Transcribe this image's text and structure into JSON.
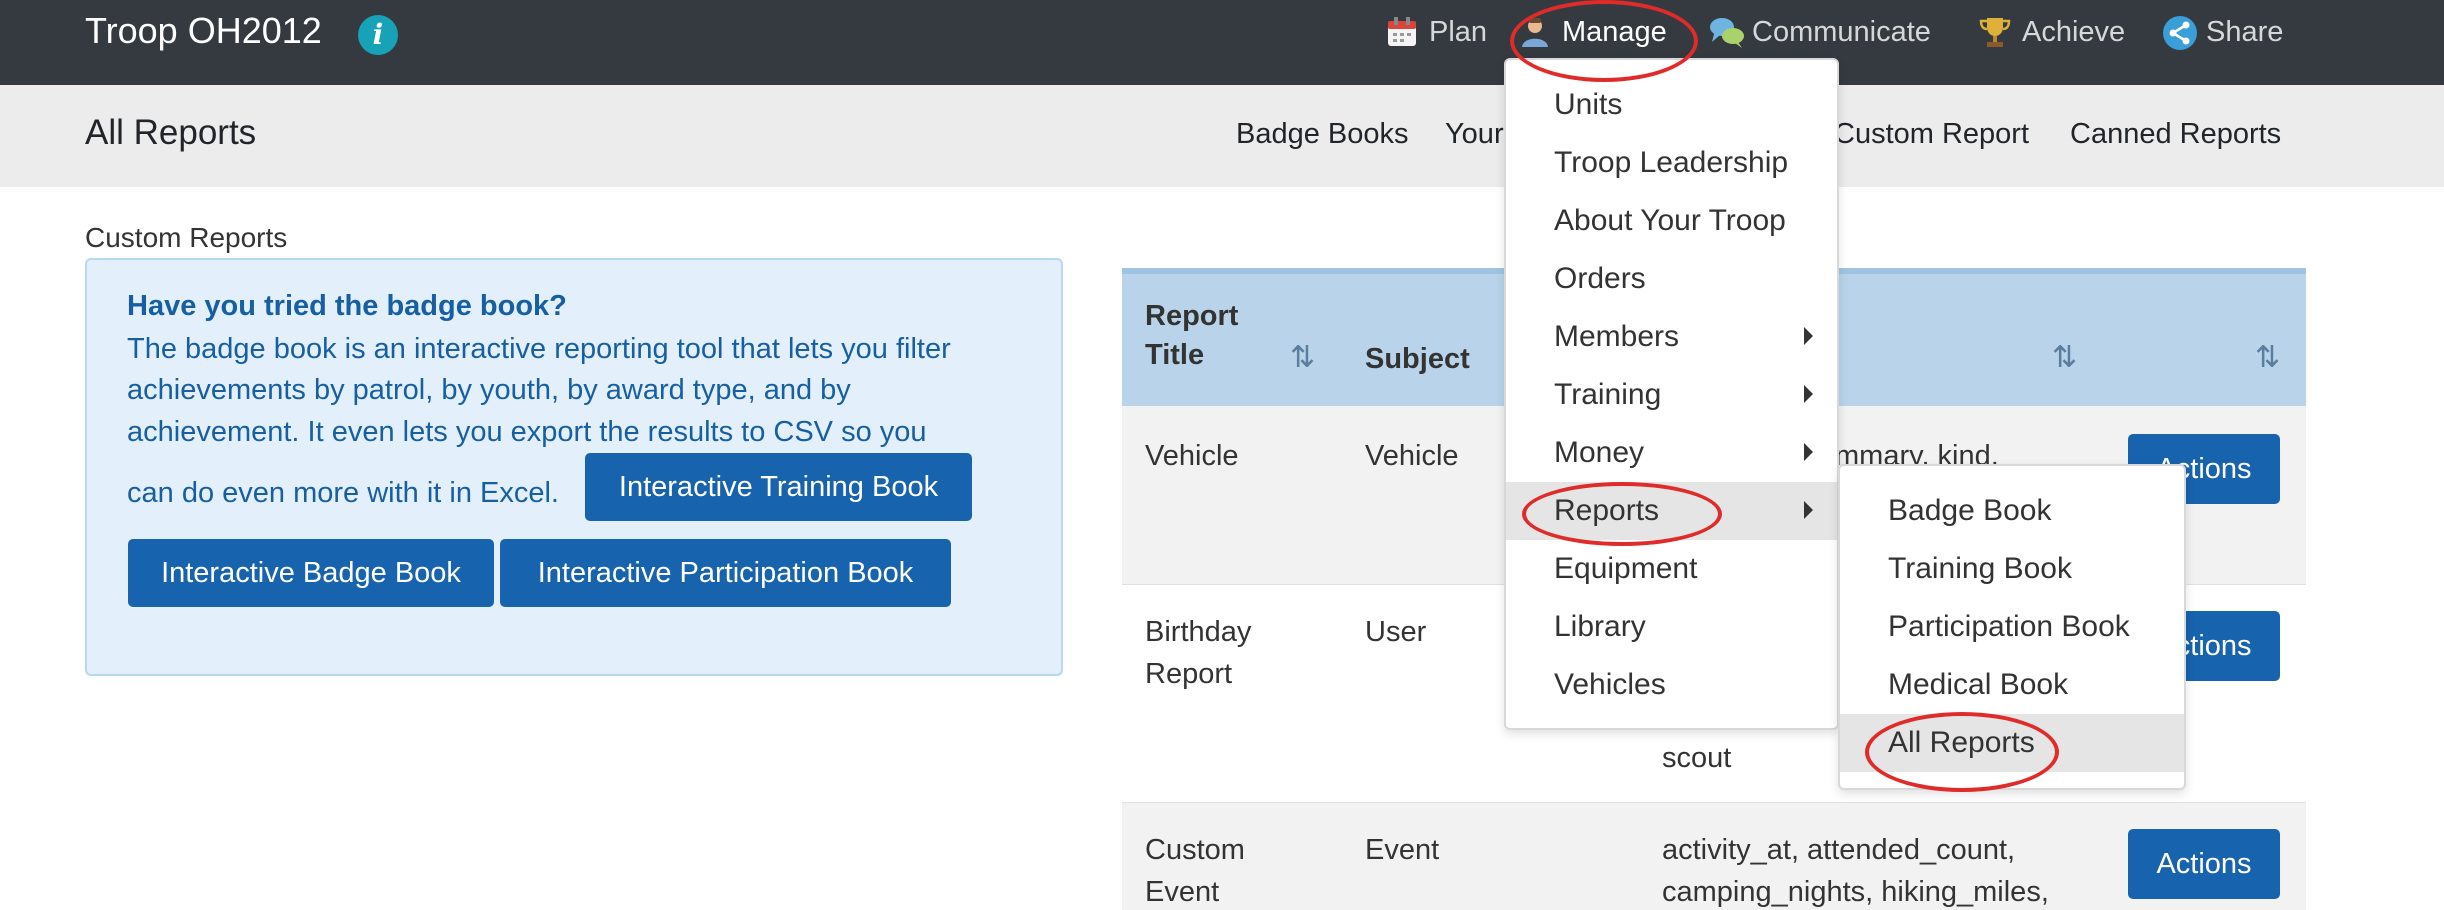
{
  "navbar": {
    "brand": "Troop OH2012",
    "items": [
      {
        "label": "Plan",
        "icon": "calendar-icon"
      },
      {
        "label": "Manage",
        "icon": "person-icon"
      },
      {
        "label": "Communicate",
        "icon": "speech-bubbles-icon"
      },
      {
        "label": "Achieve",
        "icon": "trophy-icon"
      },
      {
        "label": "Share",
        "icon": "share-icon"
      }
    ]
  },
  "subheader": {
    "title": "All Reports",
    "links": [
      "Badge Books",
      "Your",
      "Custom Report",
      "Canned Reports"
    ]
  },
  "custom_reports": {
    "heading": "Custom Reports",
    "callout": {
      "title": "Have you tried the badge book?",
      "lines": [
        "The badge book is an interactive reporting tool that lets you filter",
        "achievements by patrol, by youth, by award type, and by",
        "achievement. It even lets you export the results to CSV so you",
        "can do even more with it in Excel."
      ],
      "buttons": {
        "training": "Interactive Training Book",
        "badge": "Interactive Badge Book",
        "participation": "Interactive Participation Book"
      }
    }
  },
  "table": {
    "headers": {
      "title_line1": "Report",
      "title_line2": "Title",
      "subject": "Subject"
    },
    "rows": [
      {
        "title": [
          "Vehicle"
        ],
        "subject": "Vehicle",
        "fields": [
          "mmary, kind,"
        ],
        "action": "Actions"
      },
      {
        "title": [
          "Birthday",
          "Report"
        ],
        "subject": "User",
        "fields": [
          "scout"
        ],
        "action": "Actions"
      },
      {
        "title": [
          "Custom",
          "Event"
        ],
        "subject": "Event",
        "fields": [
          "activity_at, attended_count,",
          "camping_nights, hiking_miles,"
        ],
        "action": "Actions"
      }
    ]
  },
  "manage_menu": {
    "items": [
      {
        "label": "Units",
        "submenu": false
      },
      {
        "label": "Troop Leadership",
        "submenu": false
      },
      {
        "label": "About Your Troop",
        "submenu": false
      },
      {
        "label": "Orders",
        "submenu": false
      },
      {
        "label": "Members",
        "submenu": true
      },
      {
        "label": "Training",
        "submenu": true
      },
      {
        "label": "Money",
        "submenu": true
      },
      {
        "label": "Reports",
        "submenu": true
      },
      {
        "label": "Equipment",
        "submenu": false
      },
      {
        "label": "Library",
        "submenu": false
      },
      {
        "label": "Vehicles",
        "submenu": false
      }
    ],
    "highlighted": "Reports"
  },
  "reports_submenu": {
    "items": [
      "Badge Book",
      "Training Book",
      "Participation Book",
      "Medical Book",
      "All Reports"
    ],
    "highlighted": "All Reports"
  },
  "colors": {
    "navbar": "#343a40",
    "primary_button": "#1763ad",
    "callout_text": "#175fa3",
    "table_header": "#b9d4ea",
    "annotation": "#e02b2b"
  }
}
